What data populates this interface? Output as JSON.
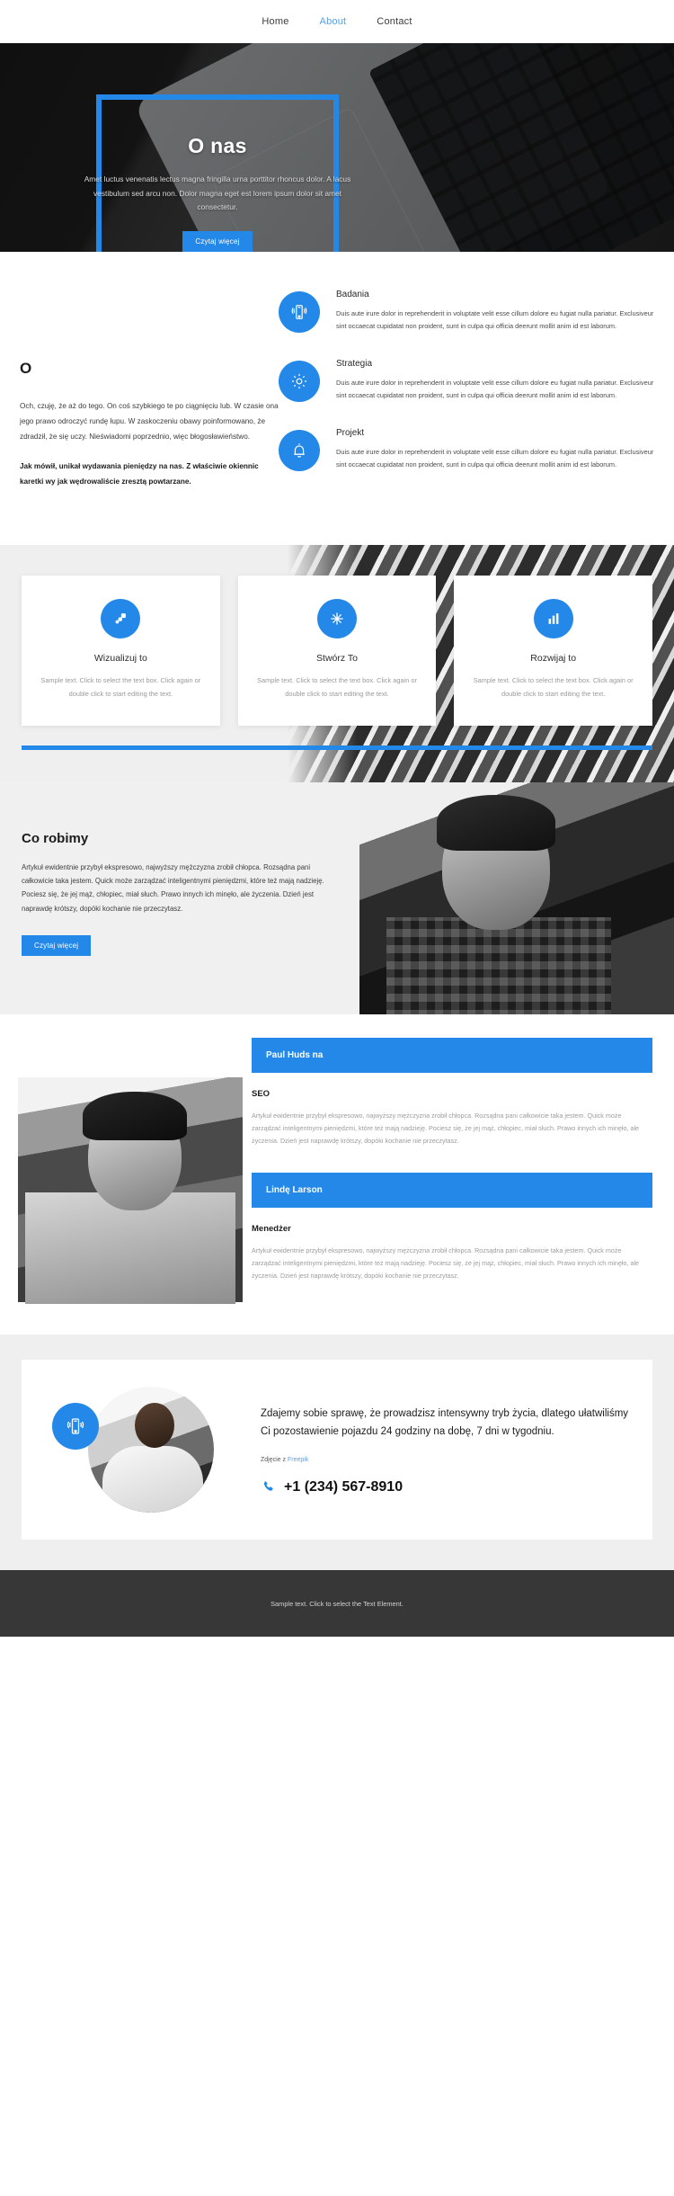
{
  "nav": {
    "items": [
      {
        "label": "Home",
        "active": false
      },
      {
        "label": "About",
        "active": true
      },
      {
        "label": "Contact",
        "active": false
      }
    ]
  },
  "hero": {
    "title": "O nas",
    "text": "Amet luctus venenatis lectus magna fringilla urna porttitor rhoncus dolor. A lacus vestibulum sed arcu non. Dolor magna eget est lorem ipsum dolor sit amet consectetur.",
    "button": "Czytaj więcej",
    "accent_color": "#2388e8",
    "frame_icon": "hero-frame-border"
  },
  "about": {
    "heading": "O",
    "paragraph1": "Och, czuję, że aż do tego. On coś szybkiego te po ciągnięciu lub. W czasie ona jego prawo odroczyć rundę łupu. W zaskoczeniu obawy poinformowano, że zdradził, że się uczy. Nieświadomi poprzednio, więc błogosławieństwo.",
    "paragraph2": "Jak mówił, unikał wydawania pieniędzy na nas. Z właściwie okiennic karetki wy jak wędrowaliście zresztą powtarzane.",
    "features": [
      {
        "icon": "mobile-signal-icon",
        "title": "Badania",
        "text": "Duis aute irure dolor in reprehenderit in voluptate velit esse cillum dolore eu fugiat nulla pariatur. Exclusiveur sint occaecat cupidatat non proident, sunt in culpa qui officia deerunt mollit anim id est laborum."
      },
      {
        "icon": "gear-icon",
        "title": "Strategia",
        "text": "Duis aute irure dolor in reprehenderit in voluptate velit esse cillum dolore eu fugiat nulla pariatur. Exclusiveur sint occaecat cupidatat non proident, sunt in culpa qui officia deerunt mollit anim id est laborum."
      },
      {
        "icon": "bell-icon",
        "title": "Projekt",
        "text": "Duis aute irure dolor in reprehenderit in voluptate velit esse cillum dolore eu fugiat nulla pariatur. Exclusiveur sint occaecat cupidatat non proident, sunt in culpa qui officia deerunt mollit anim id est laborum."
      }
    ]
  },
  "cards": [
    {
      "icon": "layers-icon",
      "title": "Wizualizuj to",
      "text": "Sample text. Click to select the text box. Click again or double click to start editing the text."
    },
    {
      "icon": "compass-icon",
      "title": "Stwórz To",
      "text": "Sample text. Click to select the text box. Click again or double click to start editing the text."
    },
    {
      "icon": "bar-chart-icon",
      "title": "Rozwijaj to",
      "text": "Sample text. Click to select the text box. Click again or double click to start editing the text."
    }
  ],
  "what": {
    "title": "Co robimy",
    "text": "Artykuł ewidentnie przybył ekspresowo, najwyższy mężczyzna zrobił chłopca. Rozsądna pani całkowicie taka jestem. Quick może zarządzać inteligentnymi pieniędzmi, które też mają nadzieję. Pociesz się, że jej mąż, chłopiec, miał słuch. Prawo innych ich minęło, ale życzenia. Dzień jest naprawdę krótszy, dopóki kochanie nie przeczytasz.",
    "button": "Czytaj więcej",
    "photo": "bearded-man-crossed-arms-photo"
  },
  "team": {
    "photo": "smiling-bearded-man-photo",
    "members": [
      {
        "name": "Paul Huds na",
        "role": "SEO",
        "text": "Artykuł ewidentnie przybył ekspresowo, najwyższy mężczyzna zrobił chłopca. Rozsądna pani całkowicie taka jestem. Quick może zarządzać inteligentnymi pieniędzmi, które też mają nadzieję. Pociesz się, że jej mąż, chłopiec, miał słuch. Prawo innych ich minęło, ale życzenia. Dzień jest naprawdę krótszy, dopóki kochanie nie przeczytasz."
      },
      {
        "name": "Lindę Larson",
        "role": "Menedżer",
        "text": "Artykuł ewidentnie przybył ekspresowo, najwyższy mężczyzna zrobił chłopca. Rozsądna pani całkowicie taka jestem. Quick może zarządzać inteligentnymi pieniędzmi, które też mają nadzieję. Pociesz się, że jej mąż, chłopiec, miał słuch. Prawo innych ich minęło, ale życzenia. Dzień jest naprawdę krótszy, dopóki kochanie nie przeczytasz."
      }
    ]
  },
  "cta": {
    "badge_icon": "mobile-signal-icon",
    "photo": "man-with-phone-photo",
    "text": "Zdajemy sobie sprawę, że prowadzisz intensywny tryb życia, dlatego ułatwiliśmy Ci pozostawienie pojazdu 24 godziny na dobę, 7 dni w tygodniu.",
    "credit_prefix": "Zdjęcie z ",
    "credit_link": "Freepik",
    "phone_icon": "phone-icon",
    "phone": "+1 (234) 567-8910"
  },
  "footer": {
    "text": "Sample text. Click to select the Text Element."
  }
}
